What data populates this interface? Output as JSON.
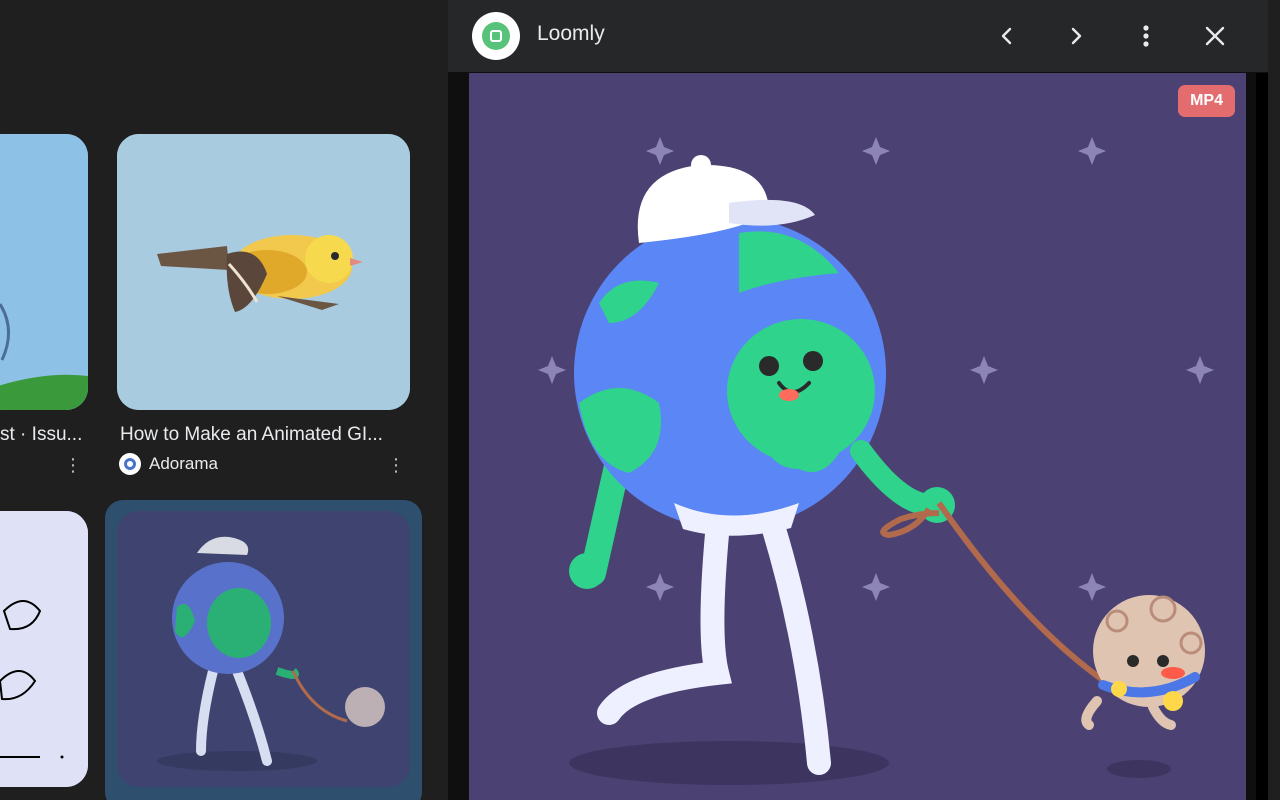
{
  "results": {
    "cards": [
      {
        "title": "st · Issu...",
        "menu": "⋮"
      },
      {
        "title": "How to Make an Animated GI...",
        "source": "Adorama",
        "menu": "⋮"
      }
    ]
  },
  "panel": {
    "site_name": "Loomly",
    "badge": "MP4",
    "nav": {
      "prev_icon": "chevron-left-icon",
      "next_icon": "chevron-right-icon",
      "more_icon": "more-vertical-icon",
      "close_icon": "close-icon"
    }
  },
  "colors": {
    "background": "#1f1f1f",
    "header": "#262729",
    "preview_bg": "#4b4273",
    "badge": "#e36c6f",
    "earth_blue": "#5b86f5",
    "earth_green": "#2fd38c"
  }
}
